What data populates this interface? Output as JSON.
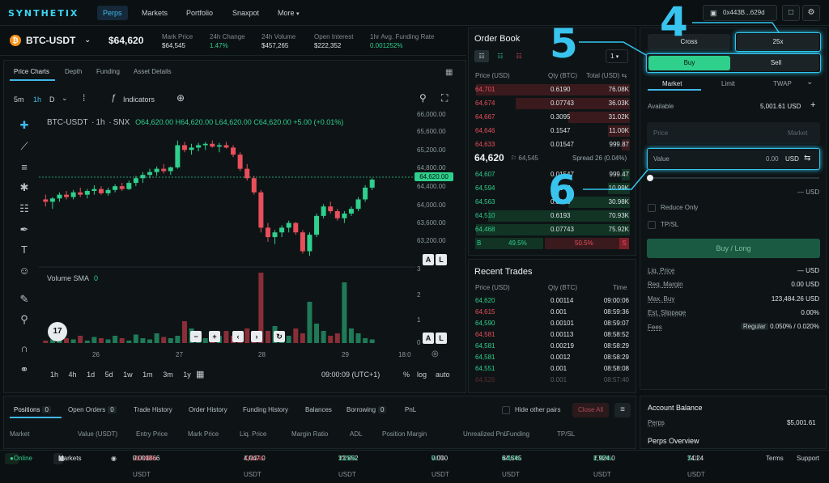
{
  "header": {
    "logo": "SYNTHETIX",
    "nav": [
      "Perps",
      "Markets",
      "Portfolio",
      "Snaxpot",
      "More"
    ],
    "wallet": "0x443B...629d"
  },
  "ticker": {
    "symbol": "BTC-USDT",
    "price": "$64,620",
    "stats": [
      {
        "label": "Mark Price",
        "value": "$64,545"
      },
      {
        "label": "24h Change",
        "value": "1.47%"
      },
      {
        "label": "24h Volume",
        "value": "$457,265"
      },
      {
        "label": "Open Interest",
        "value": "$222,352"
      },
      {
        "label": "1hr Avg. Funding Rate",
        "value": "0.001252%"
      }
    ]
  },
  "chart": {
    "tabs": [
      "Price Charts",
      "Depth",
      "Funding",
      "Asset Details"
    ],
    "intervals": [
      "5m",
      "1h",
      "D"
    ],
    "indicators_label": "Indicators",
    "legend_symbol": "BTC-USDT",
    "legend_interval": "1h",
    "legend_source": "SNX",
    "ohlc": "O64,620.00 H64,620.00 L64,620.00 C64,620.00 +5.00 (+0.01%)",
    "price_tag": "64,620.00",
    "y_ticks": [
      "66,000.00",
      "65,600.00",
      "65,200.00",
      "64,800.00",
      "64,400.00",
      "64,000.00",
      "63,600.00",
      "63,200.00"
    ],
    "x_ticks": [
      "26",
      "27",
      "28",
      "29",
      "18:0"
    ],
    "volume_label": "Volume SMA",
    "volume_value": "0",
    "vol_ticks": [
      "3",
      "2",
      "1",
      "0"
    ],
    "clock": "09:00:09 (UTC+1)",
    "scale_opts": [
      "%",
      "log",
      "auto"
    ],
    "bottom_intervals": [
      "1h",
      "4h",
      "1d",
      "5d",
      "1w",
      "1m",
      "3m",
      "1y"
    ]
  },
  "chart_data": {
    "type": "candlestick",
    "ylim": [
      62800,
      66200
    ],
    "candles": [
      [
        64200,
        64300,
        64050,
        64150
      ],
      [
        64150,
        64250,
        64000,
        64220
      ],
      [
        64220,
        64350,
        64150,
        64300
      ],
      [
        64300,
        64380,
        64200,
        64250
      ],
      [
        64250,
        64400,
        64200,
        64350
      ],
      [
        64350,
        64450,
        64250,
        64300
      ],
      [
        64300,
        64420,
        64220,
        64380
      ],
      [
        64380,
        64500,
        64300,
        64420
      ],
      [
        64420,
        64480,
        64300,
        64330
      ],
      [
        64330,
        64450,
        64280,
        64400
      ],
      [
        64400,
        64520,
        64350,
        64480
      ],
      [
        64480,
        64550,
        64380,
        64420
      ],
      [
        64420,
        64600,
        64400,
        64550
      ],
      [
        64550,
        64700,
        64480,
        64650
      ],
      [
        64650,
        64780,
        64550,
        64720
      ],
      [
        64720,
        64850,
        64650,
        64780
      ],
      [
        64780,
        64900,
        64700,
        64850
      ],
      [
        64850,
        64950,
        64750,
        64800
      ],
      [
        64800,
        64900,
        64720,
        64880
      ],
      [
        64880,
        65450,
        64850,
        65350
      ],
      [
        65350,
        65420,
        65200,
        65250
      ],
      [
        65250,
        65380,
        65150,
        65300
      ],
      [
        65300,
        65400,
        65220,
        65350
      ],
      [
        65350,
        65420,
        65250,
        65380
      ],
      [
        65380,
        65450,
        65300,
        65320
      ],
      [
        65320,
        65400,
        65200,
        65350
      ],
      [
        65350,
        65420,
        65280,
        65300
      ],
      [
        65300,
        65350,
        65100,
        65150
      ],
      [
        65150,
        65200,
        64800,
        64850
      ],
      [
        64850,
        64950,
        64600,
        64650
      ],
      [
        64650,
        64700,
        64300,
        64350
      ],
      [
        64350,
        64400,
        63500,
        63600
      ],
      [
        63600,
        63700,
        63300,
        63400
      ],
      [
        63400,
        63550,
        63250,
        63500
      ],
      [
        63500,
        63650,
        63400,
        63600
      ],
      [
        63600,
        63750,
        63500,
        63700
      ],
      [
        63700,
        63720,
        63450,
        63500
      ],
      [
        63500,
        63550,
        63050,
        63100
      ],
      [
        63100,
        63500,
        63000,
        63450
      ],
      [
        63450,
        63900,
        63400,
        63850
      ],
      [
        63850,
        64100,
        63800,
        64050
      ],
      [
        64050,
        64150,
        63900,
        63950
      ],
      [
        63950,
        64000,
        63750,
        63800
      ],
      [
        63800,
        63950,
        63700,
        63900
      ],
      [
        63900,
        64050,
        63850,
        64000
      ],
      [
        64000,
        64250,
        63950,
        64200
      ],
      [
        64200,
        64500,
        64150,
        64450
      ],
      [
        64450,
        64650,
        64400,
        64620
      ]
    ],
    "volumes": [
      0.1,
      0.15,
      0.1,
      0.2,
      0.15,
      0.3,
      0.1,
      0.25,
      0.2,
      0.15,
      0.3,
      0.2,
      0.1,
      0.35,
      0.2,
      0.15,
      0.4,
      0.25,
      0.2,
      0.3,
      0.9,
      0.6,
      0.3,
      0.2,
      0.4,
      0.3,
      0.5,
      0.3,
      0.2,
      0.6,
      0.4,
      2.9,
      0.5,
      0.7,
      0.4,
      0.3,
      0.6,
      0.4,
      1.7,
      0.8,
      0.5,
      0.3,
      0.4,
      2.5,
      0.6,
      0.4,
      0.2,
      0.15
    ]
  },
  "orderbook": {
    "title": "Order Book",
    "depth": "1",
    "headers": [
      "Price (USD)",
      "Qty (BTC)",
      "Total (USD)"
    ],
    "asks": [
      {
        "price": "64,701",
        "qty": "0.6190",
        "total": "76.08K",
        "depth": 1.0
      },
      {
        "price": "64,674",
        "qty": "0.07743",
        "total": "36.03K",
        "depth": 0.74
      },
      {
        "price": "64,667",
        "qty": "0.3095",
        "total": "31.02K",
        "depth": 0.4
      },
      {
        "price": "64,646",
        "qty": "0.1547",
        "total": "11.00K",
        "depth": 0.14
      },
      {
        "price": "64,633",
        "qty": "0.01547",
        "total": "999.87",
        "depth": 0.05
      }
    ],
    "mid_price": "64,620",
    "mid_mark": "64,545",
    "spread": "Spread 26 (0.04%)",
    "bids": [
      {
        "price": "64,607",
        "qty": "0.01547",
        "total": "999.47",
        "depth": 0.05
      },
      {
        "price": "64,594",
        "qty": "0.1547",
        "total": "10.99K",
        "depth": 0.14
      },
      {
        "price": "64,563",
        "qty": "0.3095",
        "total": "30.98K",
        "depth": 0.4
      },
      {
        "price": "64,510",
        "qty": "0.6193",
        "total": "70.93K",
        "depth": 0.92
      },
      {
        "price": "64,468",
        "qty": "0.07743",
        "total": "75.92K",
        "depth": 1.0
      }
    ],
    "buy_label": "B",
    "buy_pct": "49.5%",
    "sell_pct": "50.5%",
    "sell_label": "S"
  },
  "recent_trades": {
    "title": "Recent Trades",
    "headers": [
      "Price (USD)",
      "Qty (BTC)",
      "Time"
    ],
    "rows": [
      {
        "price": "64,620",
        "qty": "0.00114",
        "time": "09:00:06",
        "side": "buy"
      },
      {
        "price": "64,615",
        "qty": "0.001",
        "time": "08:59:36",
        "side": "sell"
      },
      {
        "price": "64,590",
        "qty": "0.00101",
        "time": "08:59:07",
        "side": "buy"
      },
      {
        "price": "64,581",
        "qty": "0.00113",
        "time": "08:58:52",
        "side": "sell"
      },
      {
        "price": "64,581",
        "qty": "0.00219",
        "time": "08:58:29",
        "side": "buy"
      },
      {
        "price": "64,581",
        "qty": "0.0012",
        "time": "08:58:29",
        "side": "buy"
      },
      {
        "price": "64,551",
        "qty": "0.001",
        "time": "08:58:08",
        "side": "buy"
      },
      {
        "price": "64,526",
        "qty": "0.001",
        "time": "08:57:40",
        "side": "sell"
      }
    ]
  },
  "trade_panel": {
    "margin_mode": "Cross",
    "leverage": "25x",
    "buy": "Buy",
    "sell": "Sell",
    "order_types": [
      "Market",
      "Limit",
      "TWAP"
    ],
    "available_label": "Available",
    "available_value": "5,001.61 USD",
    "price_placeholder": "Price",
    "price_hint": "Market",
    "value_label": "Value",
    "value_amount": "0.00",
    "value_unit": "USD",
    "slider_readout": "— USD",
    "reduce_only": "Reduce Only",
    "tpsl": "TP/SL",
    "submit": "Buy / Long",
    "rows": [
      {
        "label": "Liq. Price",
        "value": "— USD"
      },
      {
        "label": "Req. Margin",
        "value": "0.00 USD"
      },
      {
        "label": "Max. Buy",
        "value": "123,484.26 USD"
      },
      {
        "label": "Est. Slippage",
        "value": "0.00%"
      },
      {
        "label": "Fees",
        "badge": "Regular",
        "value": "0.050% / 0.020%"
      }
    ]
  },
  "annotations": {
    "n4": "4",
    "n5": "5",
    "n6": "6"
  },
  "positions": {
    "tabs": [
      {
        "label": "Positions",
        "count": "0"
      },
      {
        "label": "Open Orders",
        "count": "0"
      },
      {
        "label": "Trade History"
      },
      {
        "label": "Order History"
      },
      {
        "label": "Funding History"
      },
      {
        "label": "Balances"
      },
      {
        "label": "Borrowing",
        "count": "0"
      },
      {
        "label": "PnL"
      }
    ],
    "hide_other": "Hide other pairs",
    "close_all": "Close All",
    "columns": [
      "Market",
      "Value (USDT)",
      "Entry Price",
      "Mark Price",
      "Liq. Price",
      "Margin Ratio",
      "ADL",
      "Position Margin",
      "Unrealized PnL",
      "Funding",
      "TP/SL"
    ]
  },
  "account": {
    "title": "Account Balance",
    "perps_label": "Perps",
    "perps_value": "$5,001.61",
    "overview": "Perps Overview"
  },
  "footer": {
    "status": "Online",
    "markets": "Markets",
    "tickers": [
      {
        "sym": "PUMP-USDT",
        "price": "0.001866",
        "chg": "-10.46%",
        "dir": "down"
      },
      {
        "sym": "XAU-USDT",
        "price": "4,047.0",
        "chg": "-0.11%",
        "dir": "down"
      },
      {
        "sym": "VVV-USDT",
        "price": "12.852",
        "chg": "2.22%",
        "dir": "up"
      },
      {
        "sym": "WTI-USDT",
        "price": "0.000",
        "chg": "0",
        "dir": "up"
      },
      {
        "sym": "BTC-USDT",
        "price": "64,545",
        "chg": "1.47%",
        "dir": "up"
      },
      {
        "sym": "ETH-USDT",
        "price": "1,924.0",
        "chg": "2.17%",
        "dir": "up"
      },
      {
        "sym": "SOL-USDT",
        "price": "74.24",
        "chg": "1.",
        "dir": "up"
      }
    ],
    "terms": "Terms",
    "support": "Support"
  }
}
